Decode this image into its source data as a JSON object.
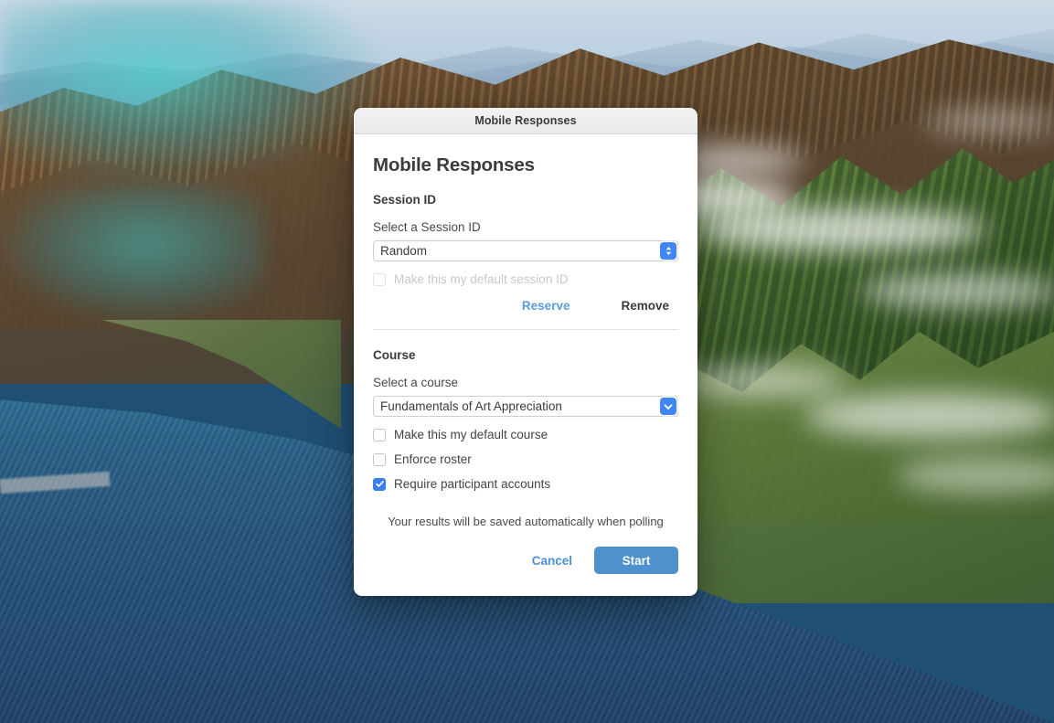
{
  "window": {
    "titlebar_title": "Mobile Responses"
  },
  "dialog": {
    "heading": "Mobile Responses",
    "session": {
      "section_title": "Session ID",
      "field_label": "Select a Session ID",
      "selected_value": "Random",
      "default_checkbox_label": "Make this my default session ID",
      "default_checkbox_checked": false,
      "default_checkbox_disabled": true,
      "reserve_label": "Reserve",
      "remove_label": "Remove"
    },
    "course": {
      "section_title": "Course",
      "field_label": "Select a course",
      "selected_value": "Fundamentals of Art Appreciation",
      "options": [
        {
          "label": "default_course",
          "text": "Make this my default course",
          "checked": false
        },
        {
          "label": "enforce_roster",
          "text": "Enforce roster",
          "checked": false
        },
        {
          "label": "require_accounts",
          "text": "Require participant accounts",
          "checked": true
        }
      ]
    },
    "note": "Your results will be saved automatically when polling",
    "footer": {
      "cancel_label": "Cancel",
      "start_label": "Start"
    }
  },
  "colors": {
    "accent_blue": "#4f91cd",
    "link_blue": "#4c8fd4",
    "checkbox_blue": "#3c7ded",
    "select_button_blue": "#4285f4",
    "titlebar_gray": "#efefef",
    "text_dark": "#3c3c3c",
    "text_disabled": "#c8c8c8"
  }
}
